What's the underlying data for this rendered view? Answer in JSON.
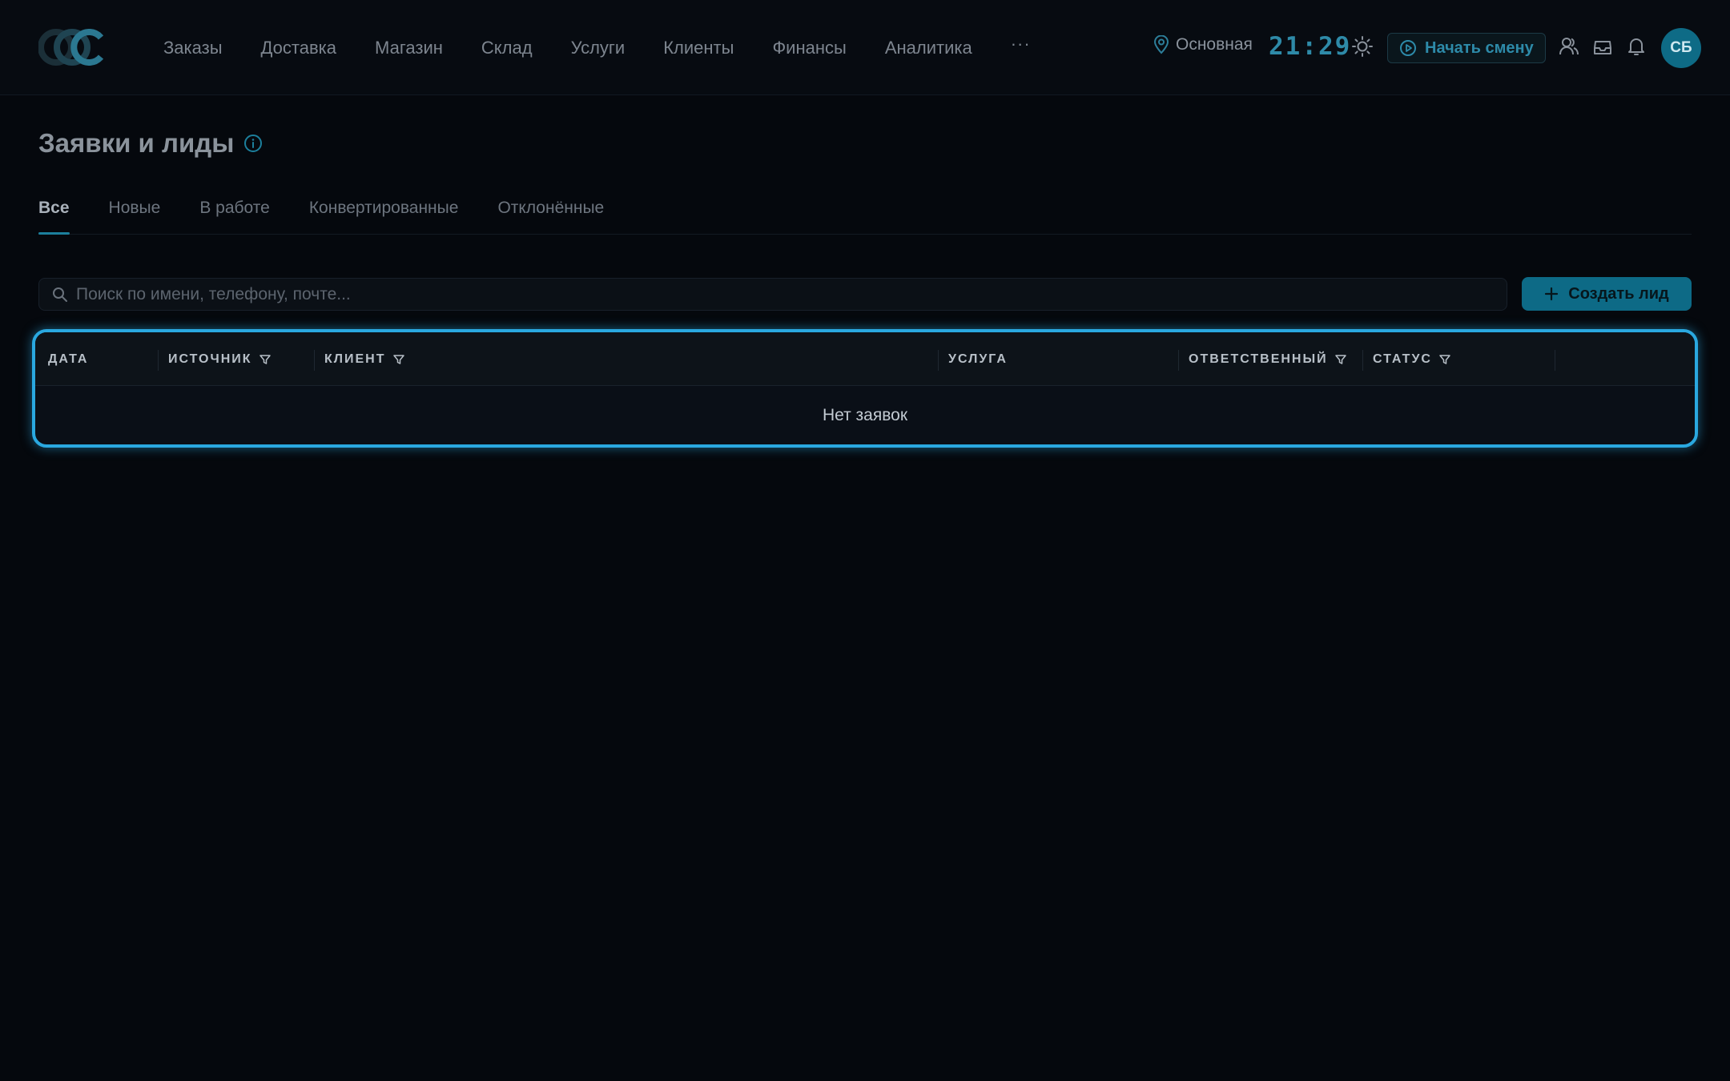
{
  "nav": {
    "items": [
      "Заказы",
      "Доставка",
      "Магазин",
      "Склад",
      "Услуги",
      "Клиенты",
      "Финансы",
      "Аналитика"
    ],
    "more": "···"
  },
  "header": {
    "branch": "Основная",
    "clock": "21:29",
    "shift_label": "Начать смену",
    "avatar_initials": "СБ"
  },
  "page": {
    "title": "Заявки и лиды"
  },
  "tabs": [
    {
      "label": "Все",
      "active": true
    },
    {
      "label": "Новые",
      "active": false
    },
    {
      "label": "В работе",
      "active": false
    },
    {
      "label": "Конвертированные",
      "active": false
    },
    {
      "label": "Отклонённые",
      "active": false
    }
  ],
  "search": {
    "placeholder": "Поиск по имени, телефону, почте..."
  },
  "create_button": "Создать лид",
  "table": {
    "columns": [
      {
        "label": "ДАТА",
        "filter": false
      },
      {
        "label": "ИСТОЧНИК",
        "filter": true
      },
      {
        "label": "КЛИЕНТ",
        "filter": true
      },
      {
        "label": "УСЛУГА",
        "filter": false
      },
      {
        "label": "ОТВЕТСТВЕННЫЙ",
        "filter": true
      },
      {
        "label": "СТАТУС",
        "filter": true
      }
    ],
    "empty_text": "Нет заявок"
  },
  "colors": {
    "accent": "#0d6a86",
    "highlight": "#2aa8e0",
    "background": "#05080d"
  }
}
